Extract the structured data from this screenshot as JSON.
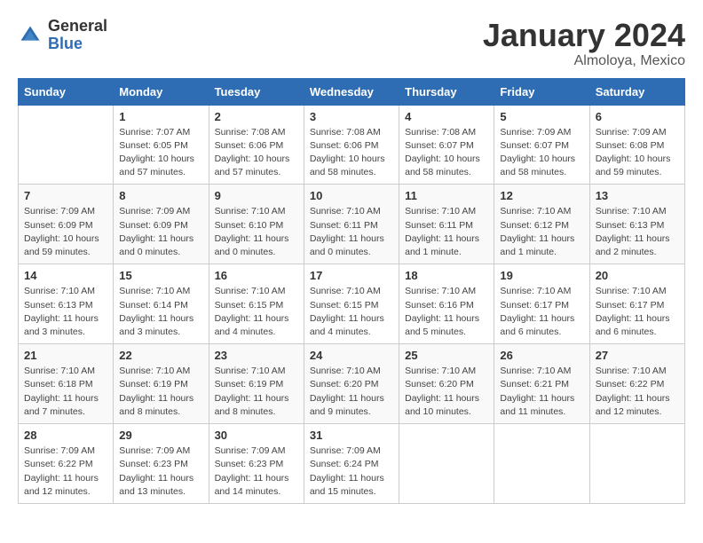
{
  "header": {
    "logo_line1": "General",
    "logo_line2": "Blue",
    "month": "January 2024",
    "location": "Almoloya, Mexico"
  },
  "calendar": {
    "days_of_week": [
      "Sunday",
      "Monday",
      "Tuesday",
      "Wednesday",
      "Thursday",
      "Friday",
      "Saturday"
    ],
    "weeks": [
      [
        {
          "day": "",
          "info": ""
        },
        {
          "day": "1",
          "info": "Sunrise: 7:07 AM\nSunset: 6:05 PM\nDaylight: 10 hours\nand 57 minutes."
        },
        {
          "day": "2",
          "info": "Sunrise: 7:08 AM\nSunset: 6:06 PM\nDaylight: 10 hours\nand 57 minutes."
        },
        {
          "day": "3",
          "info": "Sunrise: 7:08 AM\nSunset: 6:06 PM\nDaylight: 10 hours\nand 58 minutes."
        },
        {
          "day": "4",
          "info": "Sunrise: 7:08 AM\nSunset: 6:07 PM\nDaylight: 10 hours\nand 58 minutes."
        },
        {
          "day": "5",
          "info": "Sunrise: 7:09 AM\nSunset: 6:07 PM\nDaylight: 10 hours\nand 58 minutes."
        },
        {
          "day": "6",
          "info": "Sunrise: 7:09 AM\nSunset: 6:08 PM\nDaylight: 10 hours\nand 59 minutes."
        }
      ],
      [
        {
          "day": "7",
          "info": "Sunrise: 7:09 AM\nSunset: 6:09 PM\nDaylight: 10 hours\nand 59 minutes."
        },
        {
          "day": "8",
          "info": "Sunrise: 7:09 AM\nSunset: 6:09 PM\nDaylight: 11 hours\nand 0 minutes."
        },
        {
          "day": "9",
          "info": "Sunrise: 7:10 AM\nSunset: 6:10 PM\nDaylight: 11 hours\nand 0 minutes."
        },
        {
          "day": "10",
          "info": "Sunrise: 7:10 AM\nSunset: 6:11 PM\nDaylight: 11 hours\nand 0 minutes."
        },
        {
          "day": "11",
          "info": "Sunrise: 7:10 AM\nSunset: 6:11 PM\nDaylight: 11 hours\nand 1 minute."
        },
        {
          "day": "12",
          "info": "Sunrise: 7:10 AM\nSunset: 6:12 PM\nDaylight: 11 hours\nand 1 minute."
        },
        {
          "day": "13",
          "info": "Sunrise: 7:10 AM\nSunset: 6:13 PM\nDaylight: 11 hours\nand 2 minutes."
        }
      ],
      [
        {
          "day": "14",
          "info": "Sunrise: 7:10 AM\nSunset: 6:13 PM\nDaylight: 11 hours\nand 3 minutes."
        },
        {
          "day": "15",
          "info": "Sunrise: 7:10 AM\nSunset: 6:14 PM\nDaylight: 11 hours\nand 3 minutes."
        },
        {
          "day": "16",
          "info": "Sunrise: 7:10 AM\nSunset: 6:15 PM\nDaylight: 11 hours\nand 4 minutes."
        },
        {
          "day": "17",
          "info": "Sunrise: 7:10 AM\nSunset: 6:15 PM\nDaylight: 11 hours\nand 4 minutes."
        },
        {
          "day": "18",
          "info": "Sunrise: 7:10 AM\nSunset: 6:16 PM\nDaylight: 11 hours\nand 5 minutes."
        },
        {
          "day": "19",
          "info": "Sunrise: 7:10 AM\nSunset: 6:17 PM\nDaylight: 11 hours\nand 6 minutes."
        },
        {
          "day": "20",
          "info": "Sunrise: 7:10 AM\nSunset: 6:17 PM\nDaylight: 11 hours\nand 6 minutes."
        }
      ],
      [
        {
          "day": "21",
          "info": "Sunrise: 7:10 AM\nSunset: 6:18 PM\nDaylight: 11 hours\nand 7 minutes."
        },
        {
          "day": "22",
          "info": "Sunrise: 7:10 AM\nSunset: 6:19 PM\nDaylight: 11 hours\nand 8 minutes."
        },
        {
          "day": "23",
          "info": "Sunrise: 7:10 AM\nSunset: 6:19 PM\nDaylight: 11 hours\nand 8 minutes."
        },
        {
          "day": "24",
          "info": "Sunrise: 7:10 AM\nSunset: 6:20 PM\nDaylight: 11 hours\nand 9 minutes."
        },
        {
          "day": "25",
          "info": "Sunrise: 7:10 AM\nSunset: 6:20 PM\nDaylight: 11 hours\nand 10 minutes."
        },
        {
          "day": "26",
          "info": "Sunrise: 7:10 AM\nSunset: 6:21 PM\nDaylight: 11 hours\nand 11 minutes."
        },
        {
          "day": "27",
          "info": "Sunrise: 7:10 AM\nSunset: 6:22 PM\nDaylight: 11 hours\nand 12 minutes."
        }
      ],
      [
        {
          "day": "28",
          "info": "Sunrise: 7:09 AM\nSunset: 6:22 PM\nDaylight: 11 hours\nand 12 minutes."
        },
        {
          "day": "29",
          "info": "Sunrise: 7:09 AM\nSunset: 6:23 PM\nDaylight: 11 hours\nand 13 minutes."
        },
        {
          "day": "30",
          "info": "Sunrise: 7:09 AM\nSunset: 6:23 PM\nDaylight: 11 hours\nand 14 minutes."
        },
        {
          "day": "31",
          "info": "Sunrise: 7:09 AM\nSunset: 6:24 PM\nDaylight: 11 hours\nand 15 minutes."
        },
        {
          "day": "",
          "info": ""
        },
        {
          "day": "",
          "info": ""
        },
        {
          "day": "",
          "info": ""
        }
      ]
    ]
  }
}
